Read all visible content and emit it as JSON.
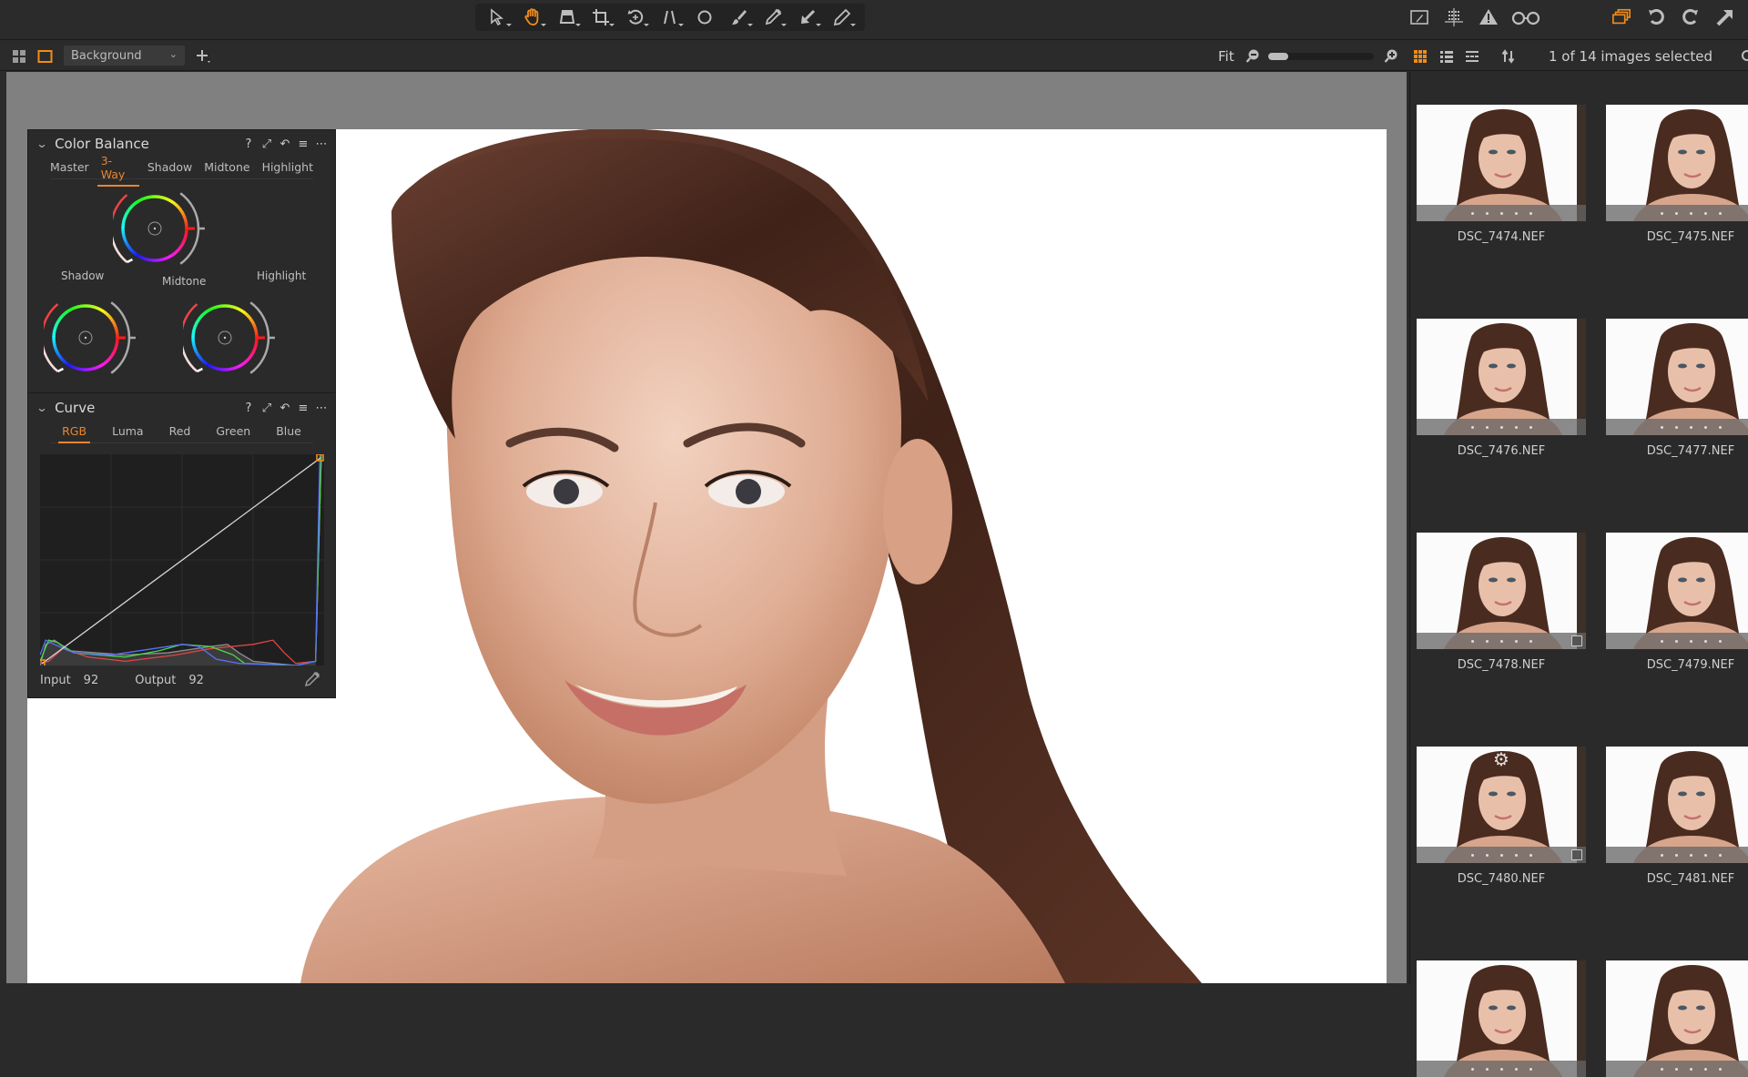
{
  "toolbar": {
    "tools": [
      {
        "name": "select-tool",
        "active": false
      },
      {
        "name": "pan-tool",
        "active": true
      },
      {
        "name": "keystone-tool",
        "active": false
      },
      {
        "name": "crop-tool",
        "active": false
      },
      {
        "name": "rotate-tool",
        "active": false
      },
      {
        "name": "straighten-tool",
        "active": false
      },
      {
        "name": "spot-removal-tool",
        "active": false
      },
      {
        "name": "brush-tool",
        "active": false
      },
      {
        "name": "color-picker-tool",
        "active": false
      },
      {
        "name": "annotate-tool",
        "active": false
      },
      {
        "name": "eraser-tool",
        "active": false
      }
    ],
    "right": [
      "edit-mask-icon",
      "grid-icon",
      "exposure-warning-icon",
      "proof-glasses-icon",
      "multi-view-icon",
      "undo-icon",
      "redo-icon",
      "export-icon"
    ],
    "accent": "#f08c1a"
  },
  "subbar": {
    "preset": "Background",
    "fit_label": "Fit",
    "zoom_level": 0.0,
    "selection_count": "1 of 14 images selected"
  },
  "color_balance": {
    "title": "Color Balance",
    "tabs": [
      "Master",
      "3-Way",
      "Shadow",
      "Midtone",
      "Highlight"
    ],
    "active_tab": "3-Way",
    "wheels": {
      "midtone": "Midtone",
      "shadow": "Shadow",
      "highlight": "Highlight"
    }
  },
  "curve": {
    "title": "Curve",
    "tabs": [
      "RGB",
      "Luma",
      "Red",
      "Green",
      "Blue"
    ],
    "active_tab": "RGB",
    "input_label": "Input",
    "input_value": "92",
    "output_label": "Output",
    "output_value": "92"
  },
  "browser": {
    "thumbnails": [
      {
        "name": "DSC_7474.NEF",
        "badge": false,
        "gear": false
      },
      {
        "name": "DSC_7475.NEF",
        "badge": false,
        "gear": false
      },
      {
        "name": "DSC_7476.NEF",
        "badge": false,
        "gear": false
      },
      {
        "name": "DSC_7477.NEF",
        "badge": false,
        "gear": false
      },
      {
        "name": "DSC_7478.NEF",
        "badge": true,
        "gear": false
      },
      {
        "name": "DSC_7479.NEF",
        "badge": false,
        "gear": false
      },
      {
        "name": "DSC_7480.NEF",
        "badge": true,
        "gear": true
      },
      {
        "name": "DSC_7481.NEF",
        "badge": false,
        "gear": false
      },
      {
        "name": "",
        "badge": false,
        "gear": false
      },
      {
        "name": "",
        "badge": false,
        "gear": false
      }
    ]
  }
}
